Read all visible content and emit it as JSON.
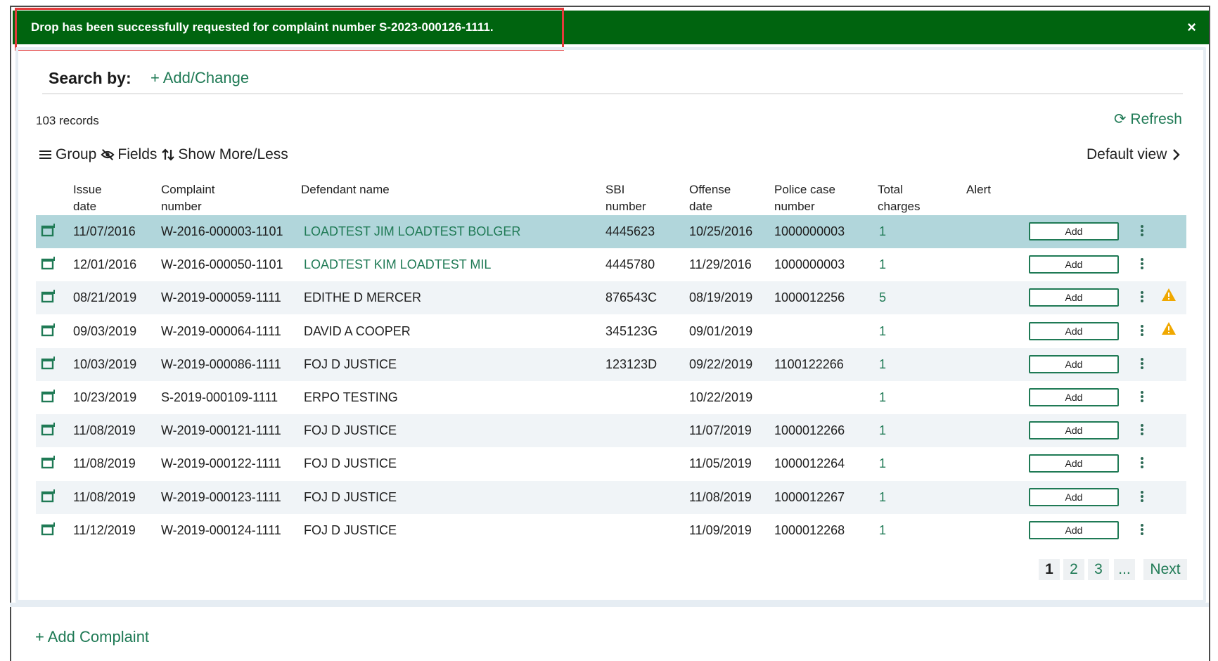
{
  "banner": {
    "message": "Drop has been successfully requested for complaint number S-2023-000126-1111.",
    "close_glyph": "×",
    "color": "#00640f",
    "highlight_color": "#e23b3b"
  },
  "search": {
    "label": "Search by:",
    "add_change": "+ Add/Change"
  },
  "records_count": "103 records",
  "refresh_label": "⟳ Refresh",
  "toolbar": {
    "group": "Group",
    "fields": "Fields",
    "show_more_less": "Show More/Less",
    "default_view": "Default view"
  },
  "columns": {
    "issue_date": [
      "Issue",
      "date"
    ],
    "complaint_number": [
      "Complaint",
      "number"
    ],
    "defendant_name": [
      "Defendant name",
      ""
    ],
    "sbi_number": [
      "SBI",
      "number"
    ],
    "offense_date": [
      "Offense",
      "date"
    ],
    "police_case_number": [
      "Police case",
      "number"
    ],
    "total_charges": [
      "Total",
      "charges"
    ],
    "alert": [
      "Alert",
      ""
    ]
  },
  "rows": [
    {
      "issue_date": "11/07/2016",
      "complaint": "W-2016-000003-1101",
      "defendant": "LOADTEST JIM LOADTEST BOLGER",
      "sbi": "4445623",
      "offense_date": "10/25/2016",
      "police_case": "1000000003",
      "charges": "1",
      "add": "Add"
    },
    {
      "issue_date": "12/01/2016",
      "complaint": "W-2016-000050-1101",
      "defendant": "LOADTEST KIM LOADTEST MIL",
      "sbi": "4445780",
      "offense_date": "11/29/2016",
      "police_case": "1000000003",
      "charges": "1",
      "add": "Add"
    },
    {
      "issue_date": "08/21/2019",
      "complaint": "W-2019-000059-1111",
      "defendant": "EDITHE D MERCER",
      "sbi": "876543C",
      "offense_date": "08/19/2019",
      "police_case": "1000012256",
      "charges": "5",
      "add": "Add"
    },
    {
      "issue_date": "09/03/2019",
      "complaint": "W-2019-000064-1111",
      "defendant": "DAVID A COOPER",
      "sbi": "345123G",
      "offense_date": "09/01/2019",
      "police_case": "",
      "charges": "1",
      "add": "Add"
    },
    {
      "issue_date": "10/03/2019",
      "complaint": "W-2019-000086-1111",
      "defendant": "FOJ D JUSTICE",
      "sbi": "123123D",
      "offense_date": "09/22/2019",
      "police_case": "1100122266",
      "charges": "1",
      "add": "Add"
    },
    {
      "issue_date": "10/23/2019",
      "complaint": "S-2019-000109-1111",
      "defendant": "ERPO TESTING",
      "sbi": "",
      "offense_date": "10/22/2019",
      "police_case": "",
      "charges": "1",
      "add": "Add"
    },
    {
      "issue_date": "11/08/2019",
      "complaint": "W-2019-000121-1111",
      "defendant": "FOJ D JUSTICE",
      "sbi": "",
      "offense_date": "11/07/2019",
      "police_case": "1000012266",
      "charges": "1",
      "add": "Add"
    },
    {
      "issue_date": "11/08/2019",
      "complaint": "W-2019-000122-1111",
      "defendant": "FOJ D JUSTICE",
      "sbi": "",
      "offense_date": "11/05/2019",
      "police_case": "1000012264",
      "charges": "1",
      "add": "Add"
    },
    {
      "issue_date": "11/08/2019",
      "complaint": "W-2019-000123-1111",
      "defendant": "FOJ D JUSTICE",
      "sbi": "",
      "offense_date": "11/08/2019",
      "police_case": "1000012267",
      "charges": "1",
      "add": "Add"
    },
    {
      "issue_date": "11/12/2019",
      "complaint": "W-2019-000124-1111",
      "defendant": "FOJ D JUSTICE",
      "sbi": "",
      "offense_date": "11/09/2019",
      "police_case": "1000012268",
      "charges": "1",
      "add": "Add"
    }
  ],
  "pagination": {
    "pages": [
      "1",
      "2",
      "3"
    ],
    "ellipsis": "...",
    "next": "Next"
  },
  "add_complaint": "+ Add Complaint",
  "icons": {
    "row_icon": "calendar-icon",
    "alert_icon": "warning-icon",
    "menu_icon": "kebab-menu-icon"
  },
  "colors": {
    "accent": "#1f7a55",
    "selected_row": "#b1d6db",
    "shaded_row": "#f0f4f7",
    "warning": "#f0a800"
  }
}
